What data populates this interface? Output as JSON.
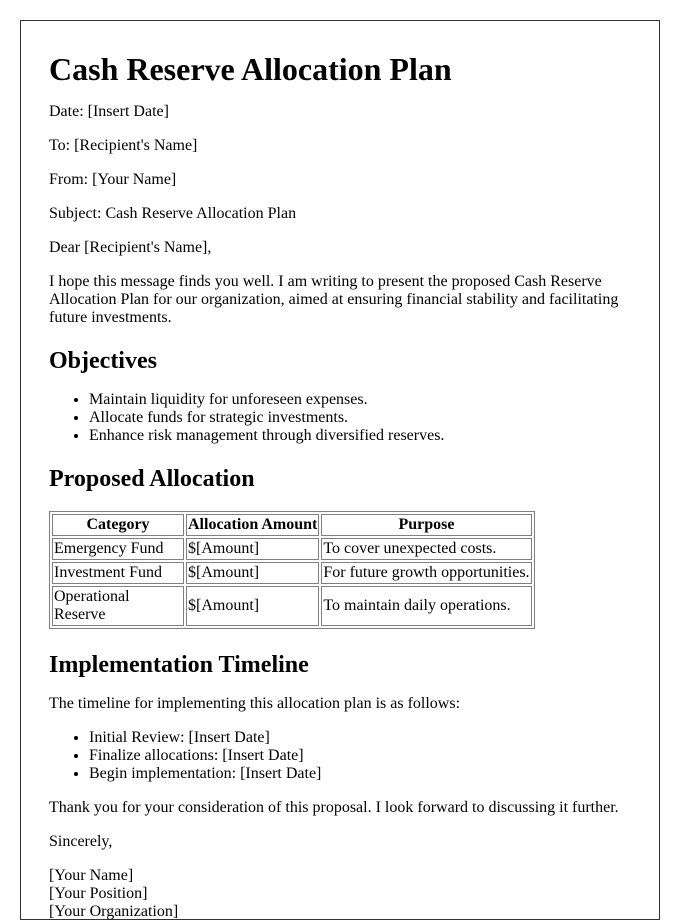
{
  "title": "Cash Reserve Allocation Plan",
  "header_fields": {
    "date": "Date: [Insert Date]",
    "to": "To: [Recipient's Name]",
    "from": "From: [Your Name]",
    "subject": "Subject: Cash Reserve Allocation Plan"
  },
  "salutation": "Dear [Recipient's Name],",
  "intro": "I hope this message finds you well. I am writing to present the proposed Cash Reserve Allocation Plan for our organization, aimed at ensuring financial stability and facilitating future investments.",
  "objectives": {
    "heading": "Objectives",
    "items": [
      "Maintain liquidity for unforeseen expenses.",
      "Allocate funds for strategic investments.",
      "Enhance risk management through diversified reserves."
    ]
  },
  "allocation": {
    "heading": "Proposed Allocation",
    "columns": [
      "Category",
      "Allocation Amount",
      "Purpose"
    ],
    "rows": [
      [
        "Emergency Fund",
        "$[Amount]",
        "To cover unexpected costs."
      ],
      [
        "Investment Fund",
        "$[Amount]",
        "For future growth opportunities."
      ],
      [
        "Operational Reserve",
        "$[Amount]",
        "To maintain daily operations."
      ]
    ]
  },
  "timeline": {
    "heading": "Implementation Timeline",
    "intro": "The timeline for implementing this allocation plan is as follows:",
    "items": [
      "Initial Review: [Insert Date]",
      "Finalize allocations: [Insert Date]",
      "Begin implementation: [Insert Date]"
    ]
  },
  "closing": "Thank you for your consideration of this proposal. I look forward to discussing it further.",
  "signoff": "Sincerely,",
  "signature": [
    "[Your Name]",
    "[Your Position]",
    "[Your Organization]"
  ]
}
